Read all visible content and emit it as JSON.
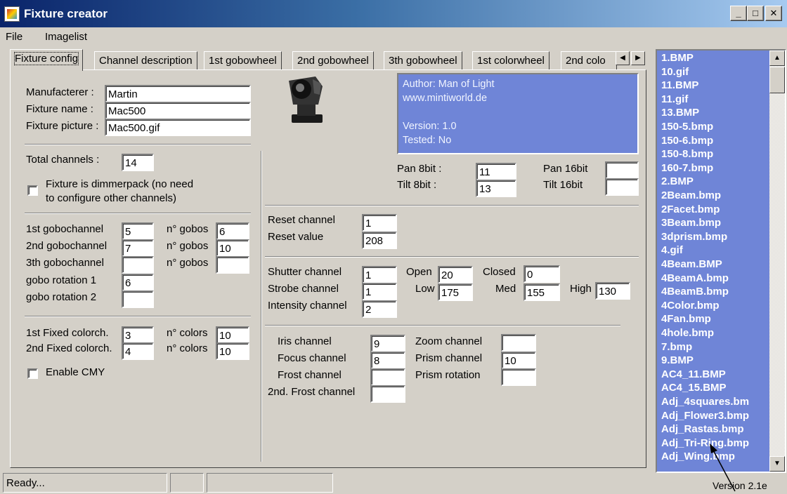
{
  "window": {
    "title": "Fixture creator",
    "minimize_glyph": "_",
    "maximize_glyph": "□",
    "close_glyph": "✕"
  },
  "menu": {
    "items": [
      "File",
      "Imagelist"
    ]
  },
  "tabs": [
    "Fixture config",
    "Channel description",
    "1st gobowheel",
    "2nd gobowheel",
    "3th gobowheel",
    "1st colorwheel",
    "2nd colo"
  ],
  "tab_scroll": {
    "left": "◀",
    "right": "▶"
  },
  "fixture": {
    "manufacturer_label": "Manufacterer :",
    "manufacturer": "Martin",
    "name_label": "Fixture name :",
    "name": "Mac500",
    "picture_label": "Fixture picture :",
    "picture": "Mac500.gif"
  },
  "info": {
    "lines": [
      "Author: Man of Light",
      "www.mintiworld.de",
      "",
      "Version: 1.0",
      "Tested: No"
    ]
  },
  "channels": {
    "total_label": "Total channels :",
    "total": "14",
    "dimmer_label_1": "Fixture is dimmerpack (no need",
    "dimmer_label_2": "to configure other channels)"
  },
  "pan_tilt": {
    "pan8_label": "Pan 8bit :",
    "pan8": "11",
    "tilt8_label": "Tilt 8bit :",
    "tilt8": "13",
    "pan16_label": "Pan 16bit",
    "pan16": "",
    "tilt16_label": "Tilt 16bit",
    "tilt16": ""
  },
  "gobos": {
    "gobo1_label": "1st gobochannel",
    "gobo1": "5",
    "n1_label": "n° gobos",
    "n1": "6",
    "gobo2_label": "2nd gobochannel",
    "gobo2": "7",
    "n2_label": "n° gobos",
    "n2": "10",
    "gobo3_label": "3th gobochannel",
    "gobo3": "",
    "n3_label": "n° gobos",
    "n3": "",
    "rot1_label": "gobo rotation 1",
    "rot1": "6",
    "rot2_label": "gobo rotation 2",
    "rot2": ""
  },
  "reset": {
    "channel_label": "Reset channel",
    "channel": "1",
    "value_label": "Reset value",
    "value": "208"
  },
  "shutter": {
    "shutter_label": "Shutter channel",
    "shutter": "1",
    "strobe_label": "Strobe channel",
    "strobe": "1",
    "intensity_label": "Intensity channel",
    "intensity": "2",
    "open_label": "Open",
    "open": "20",
    "closed_label": "Closed",
    "closed": "0",
    "low_label": "Low",
    "low": "175",
    "med_label": "Med",
    "med": "155",
    "high_label": "High",
    "high": "130"
  },
  "colors": {
    "fixed1_label": "1st Fixed colorch.",
    "fixed1": "3",
    "nc1_label": "n° colors",
    "nc1": "10",
    "fixed2_label": "2nd Fixed colorch.",
    "fixed2": "4",
    "nc2_label": "n° colors",
    "nc2": "10",
    "cmy_label": "Enable CMY"
  },
  "optics": {
    "iris_label": "Iris channel",
    "iris": "9",
    "focus_label": "Focus channel",
    "focus": "8",
    "frost_label": "Frost channel",
    "frost": "",
    "frost2_label": "2nd. Frost channel",
    "frost2": "",
    "zoom_label": "Zoom channel",
    "zoom": "",
    "prism_label": "Prism channel",
    "prism": "10",
    "prism_rot_label": "Prism rotation",
    "prism_rot": ""
  },
  "imagelist": [
    "1.BMP",
    "10.gif",
    "11.BMP",
    "11.gif",
    "13.BMP",
    "150-5.bmp",
    "150-6.bmp",
    "150-8.bmp",
    "160-7.bmp",
    "2.BMP",
    "2Beam.bmp",
    "2Facet.bmp",
    "3Beam.bmp",
    "3dprism.bmp",
    "4.gif",
    "4Beam.BMP",
    "4BeamA.bmp",
    "4BeamB.bmp",
    "4Color.bmp",
    "4Fan.bmp",
    "4hole.bmp",
    "7.bmp",
    "9.BMP",
    "AC4_11.BMP",
    "AC4_15.BMP",
    "Adj_4squares.bm",
    "Adj_Flower3.bmp",
    "Adj_Rastas.bmp",
    "Adj_Tri-Ring.bmp",
    "Adj_Wing.bmp"
  ],
  "scrollbar": {
    "up": "▲",
    "down": "▼"
  },
  "status": {
    "text": "Ready..."
  },
  "version": "Version 2.1e"
}
